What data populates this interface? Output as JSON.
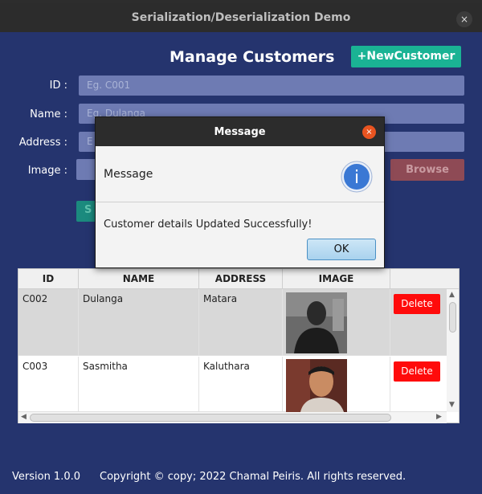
{
  "window": {
    "title": "Serialization/Deserialization Demo",
    "close_glyph": "×"
  },
  "main": {
    "heading": "Manage Customers",
    "new_button": "+NewCustomer",
    "browse_button": "Browse",
    "save_button_partial": "S",
    "fields": {
      "id_label": "ID :",
      "id_placeholder": "Eg. C001",
      "name_label": "Name :",
      "name_placeholder": "Eg. Dulanga",
      "address_label": "Address :",
      "address_placeholder": "E",
      "image_label": "Image :"
    }
  },
  "table": {
    "headers": [
      "ID",
      "NAME",
      "ADDRESS",
      "IMAGE"
    ],
    "rows": [
      {
        "id": "C002",
        "name": "Dulanga",
        "address": "Matara",
        "action": "Delete"
      },
      {
        "id": "C003",
        "name": "Sasmitha",
        "address": "Kaluthara",
        "action": "Delete"
      }
    ]
  },
  "footer": {
    "version": "Version 1.0.0",
    "copyright": "Copyright © copy; 2022 Chamal Peiris. All rights reserved."
  },
  "dialog": {
    "title": "Message",
    "header": "Message",
    "content": "Customer details Updated Successfully!",
    "ok_button": "OK",
    "close_glyph": "×",
    "info_glyph": "i"
  }
}
